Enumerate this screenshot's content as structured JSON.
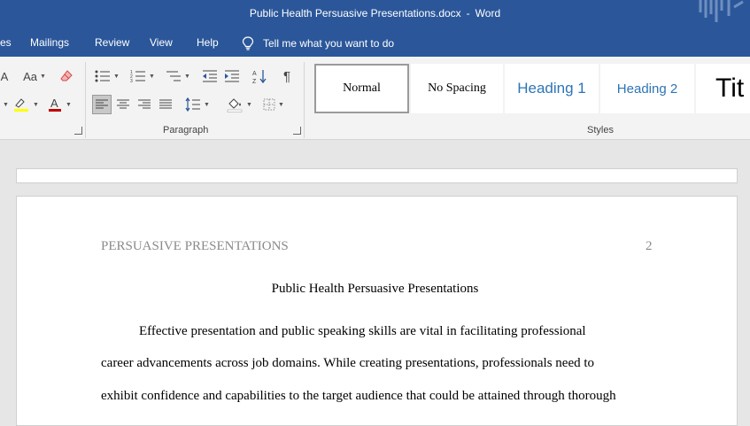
{
  "window": {
    "doc_name": "Public Health Persuasive Presentations.docx",
    "separator": "-",
    "app_name": "Word"
  },
  "menu": {
    "items": [
      "es",
      "Mailings",
      "Review",
      "View",
      "Help"
    ],
    "tell_me": "Tell me what you want to do"
  },
  "ribbon": {
    "font_group": {
      "change_case": "Aa"
    },
    "paragraph_group": {
      "label": "Paragraph"
    },
    "styles_group": {
      "label": "Styles",
      "items": [
        "Normal",
        "No Spacing",
        "Heading 1",
        "Heading 2",
        "Tit"
      ],
      "selected": "Normal"
    }
  },
  "document": {
    "running_head": "PERSUASIVE PRESENTATIONS",
    "page_number": "2",
    "title": "Public Health Persuasive Presentations",
    "lines": [
      "Effective presentation and public speaking skills are vital in facilitating professional",
      "career advancements across job domains. While creating presentations, professionals need to",
      "exhibit confidence and capabilities to the target audience that could be attained through thorough"
    ]
  },
  "colors": {
    "word_blue": "#2b579a",
    "heading_blue": "#2e74b5",
    "highlight_yellow": "#ffff00",
    "font_color_red": "#c00000"
  }
}
